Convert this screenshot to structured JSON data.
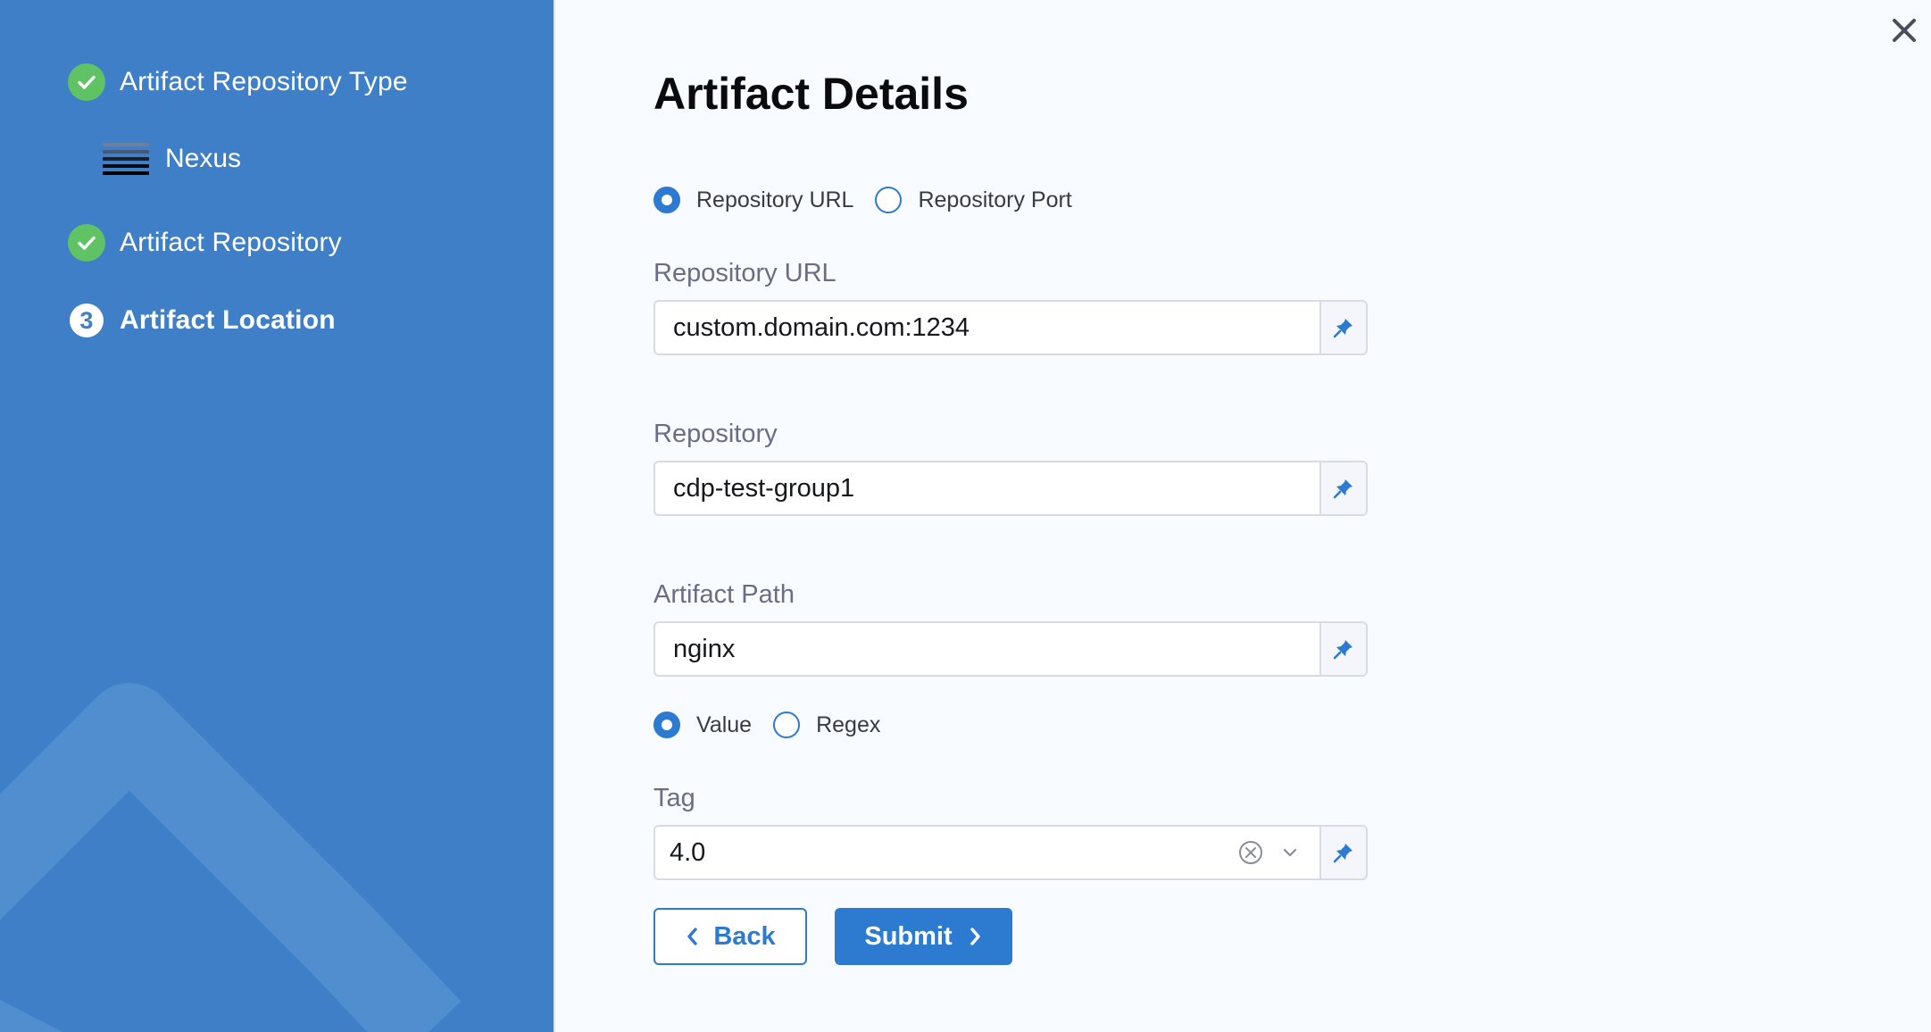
{
  "sidebar": {
    "steps": [
      {
        "label": "Artifact Repository Type",
        "state": "done"
      },
      {
        "label": "Artifact Repository",
        "state": "done"
      },
      {
        "label": "Artifact Location",
        "state": "current",
        "number": "3"
      }
    ],
    "selected_type": {
      "label": "Nexus",
      "icon": "nexus-icon"
    }
  },
  "header": {
    "title": "Artifact Details",
    "close_icon": "close-icon"
  },
  "form": {
    "repo_mode": {
      "options": [
        "Repository URL",
        "Repository Port"
      ],
      "selected": "Repository URL"
    },
    "repository_url": {
      "label": "Repository URL",
      "value": "custom.domain.com:1234"
    },
    "repository": {
      "label": "Repository",
      "value": "cdp-test-group1"
    },
    "artifact_path": {
      "label": "Artifact Path",
      "value": "nginx"
    },
    "tag_mode": {
      "options": [
        "Value",
        "Regex"
      ],
      "selected": "Value"
    },
    "tag": {
      "label": "Tag",
      "value": "4.0"
    }
  },
  "buttons": {
    "back_label": "Back",
    "submit_label": "Submit"
  },
  "colors": {
    "sidebar_bg": "#3e7fc8",
    "accent": "#2d7ad1",
    "success": "#5fc265",
    "page_bg": "#f8fbff"
  }
}
